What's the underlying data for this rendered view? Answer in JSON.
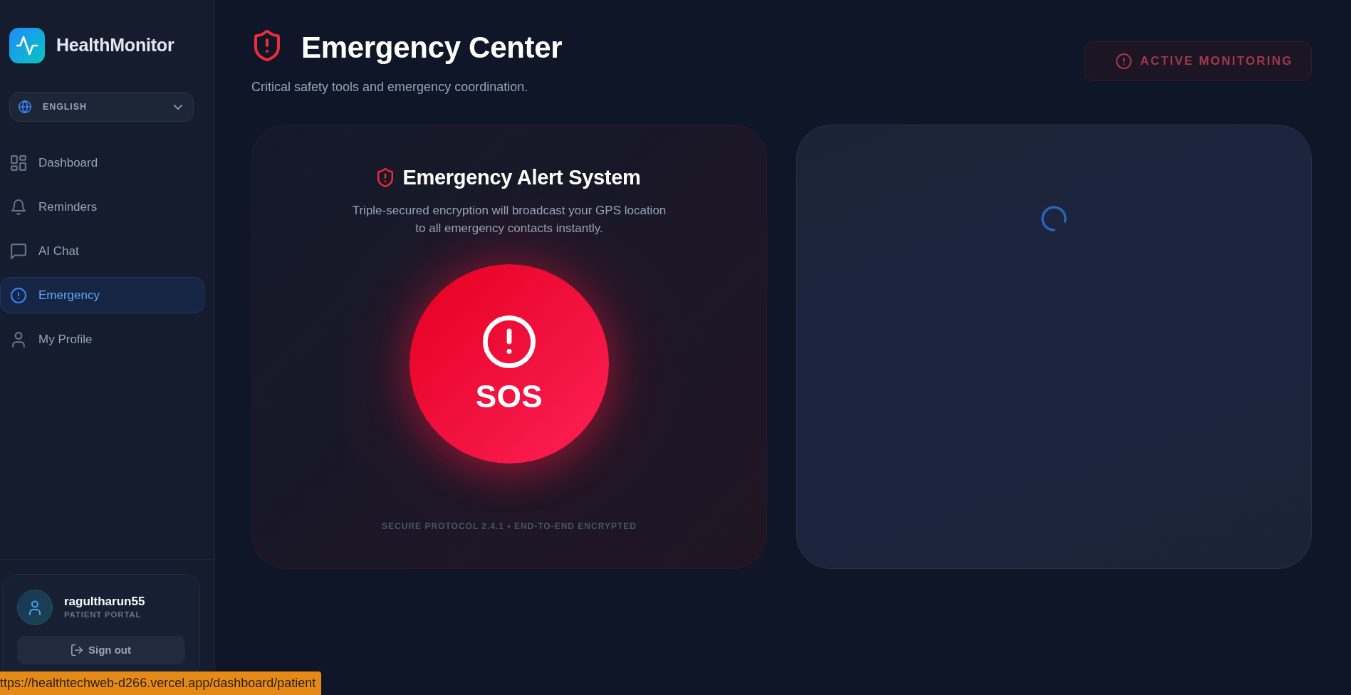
{
  "sidebar": {
    "brand": "HealthMonitor",
    "language": "ENGLISH",
    "items": [
      {
        "label": "Dashboard",
        "selected": false
      },
      {
        "label": "Reminders",
        "selected": false
      },
      {
        "label": "AI Chat",
        "selected": false
      },
      {
        "label": "Emergency",
        "selected": true
      },
      {
        "label": "My Profile",
        "selected": false
      }
    ],
    "user": {
      "name": "ragultharun55",
      "role": "PATIENT PORTAL"
    },
    "sign_out": "Sign out"
  },
  "header": {
    "title": "Emergency Center",
    "subtitle": "Critical safety tools and emergency coordination.",
    "status": "ACTIVE MONITORING"
  },
  "alert_card": {
    "title": "Emergency Alert System",
    "description": "Triple-secured encryption will broadcast your GPS location to all emergency contacts instantly.",
    "button": "SOS",
    "footer": "SECURE PROTOCOL 2.4.1 • END-TO-END ENCRYPTED"
  },
  "side_panel": {
    "loading": true
  },
  "status_bar": {
    "url": "ttps://healthtechweb-d266.vercel.app/dashboard/patient"
  }
}
